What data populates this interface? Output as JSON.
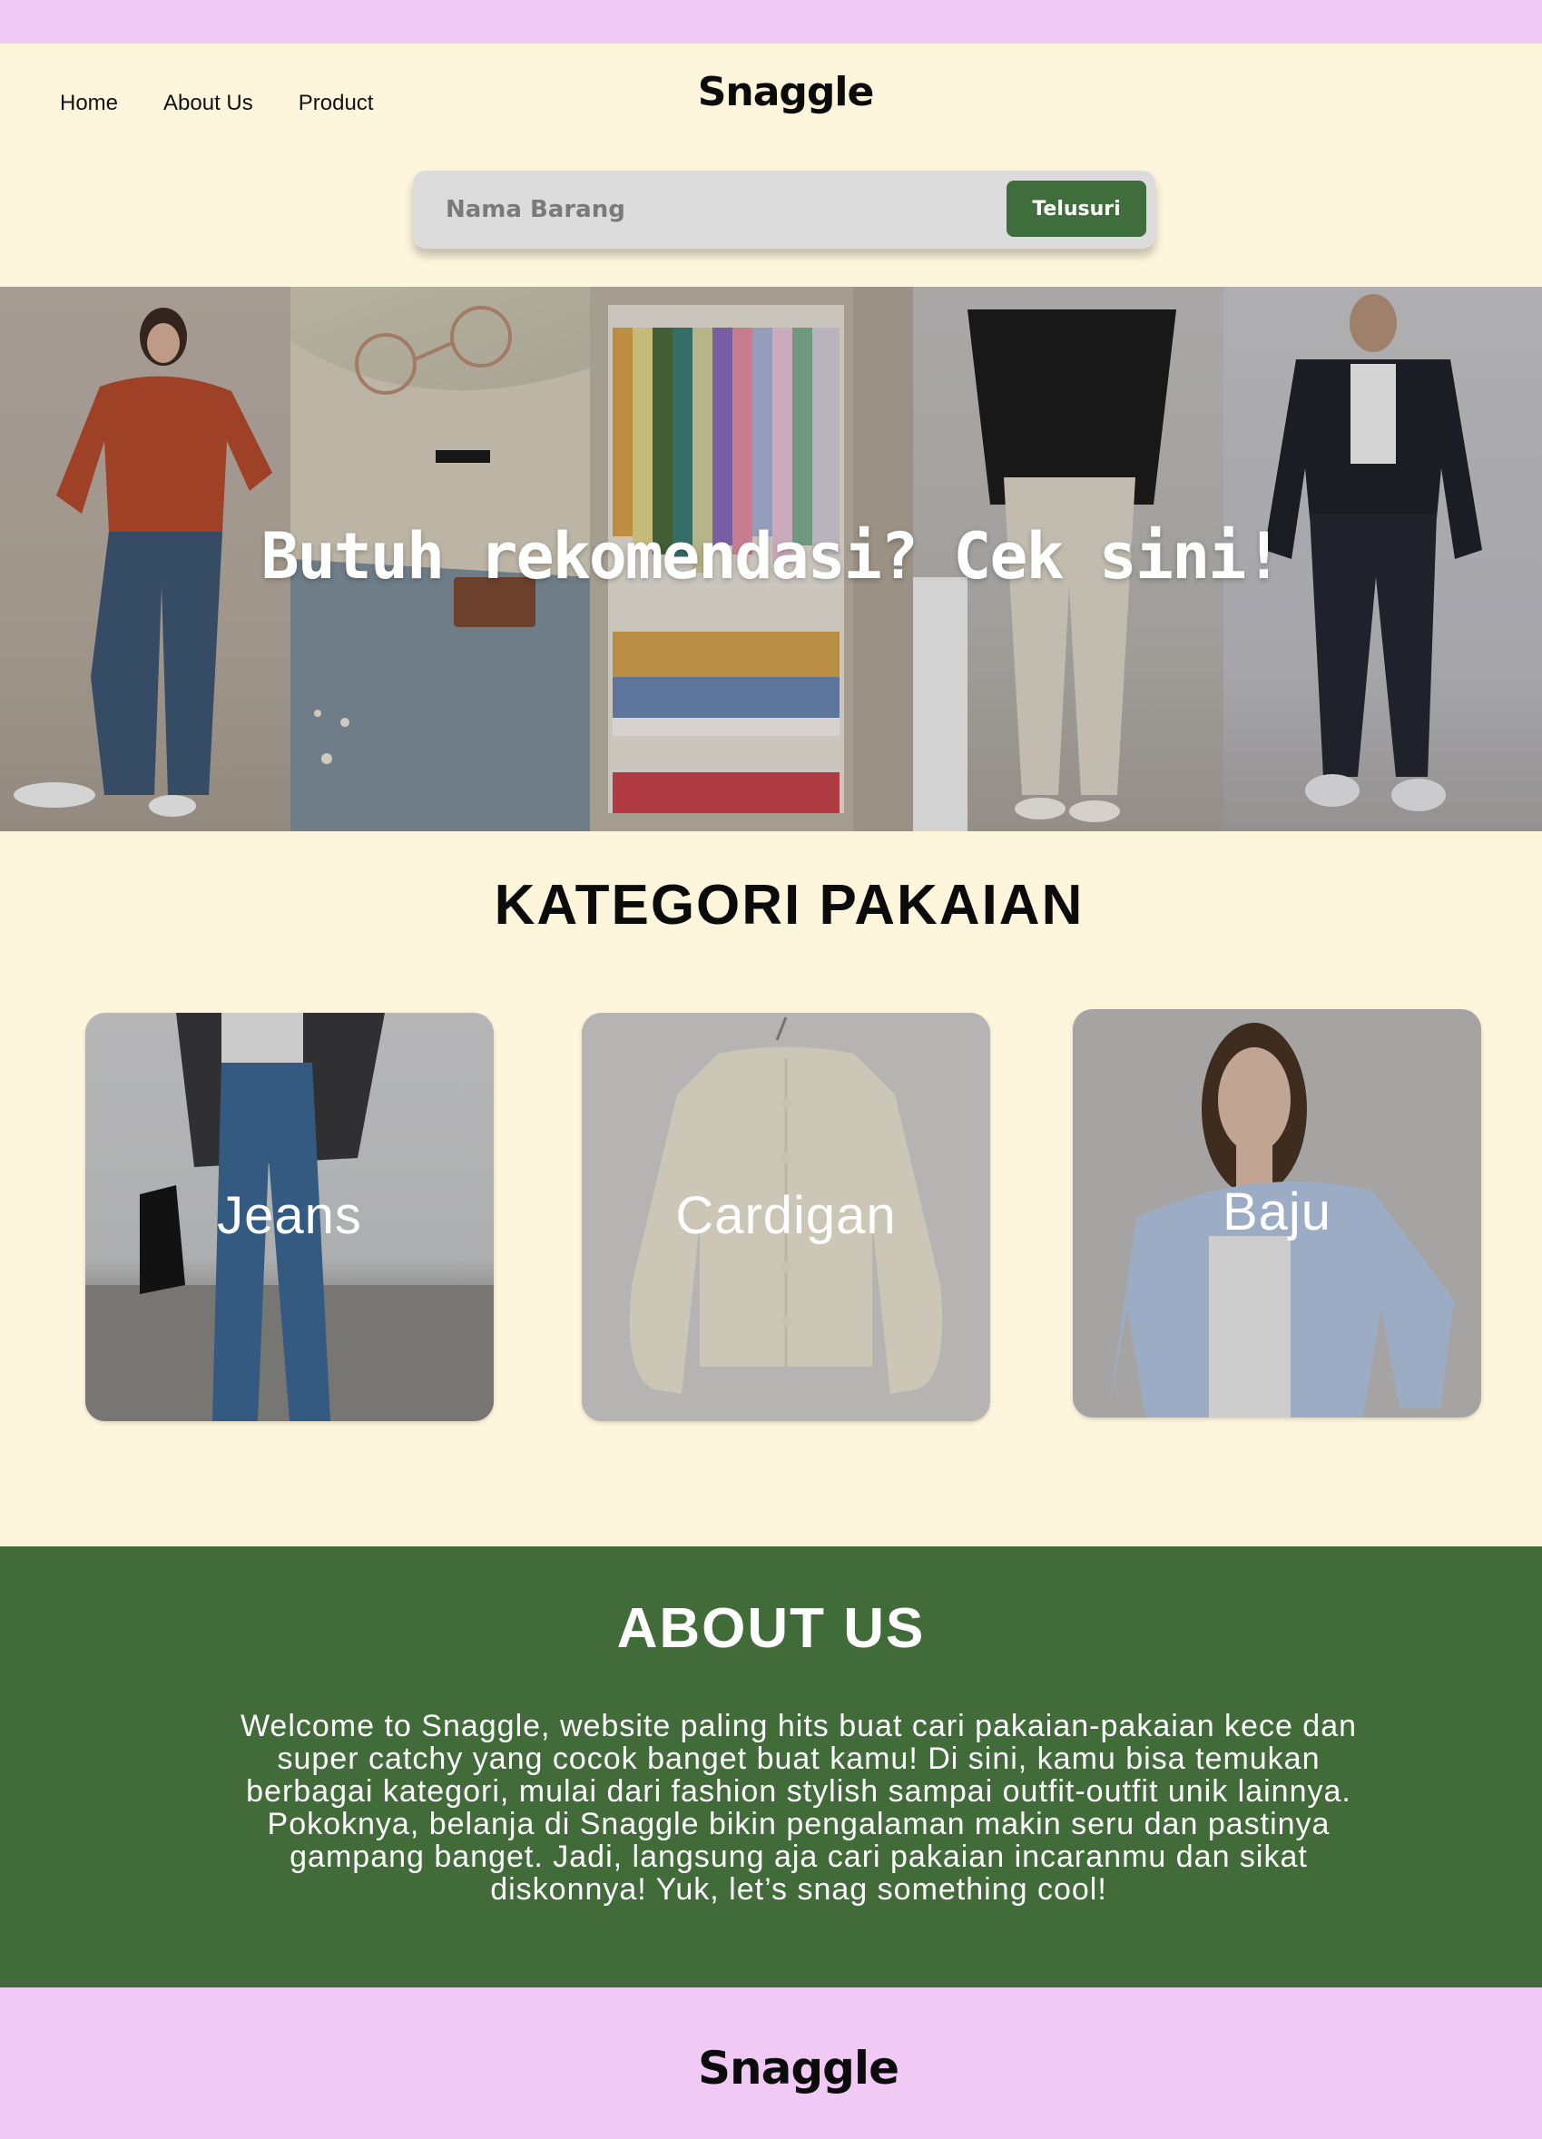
{
  "nav": {
    "items": [
      "Home",
      "About Us",
      "Product"
    ]
  },
  "brand": {
    "name": "Snaggle"
  },
  "search": {
    "placeholder": "Nama Barang",
    "button_label": "Telusuri"
  },
  "hero": {
    "title": "Butuh rekomendasi? Cek sini!"
  },
  "categories": {
    "title": "KATEGORI PAKAIAN",
    "items": [
      "Jeans",
      "Cardigan",
      "Baju"
    ]
  },
  "about": {
    "title": "ABOUT US",
    "text": "Welcome to Snaggle, website paling hits buat cari pakaian-pakaian kece dan super catchy yang cocok banget buat kamu! Di sini, kamu bisa temukan berbagai kategori, mulai dari fashion stylish sampai outfit-outfit unik lainnya. Pokoknya, belanja di Snaggle bikin pengalaman makin seru dan pastinya gampang banget. Jadi, langsung aja cari pakaian incaranmu dan sikat diskonnya! Yuk, let’s snag something cool!"
  },
  "footer": {
    "brand": "Snaggle"
  },
  "colors": {
    "accent_pink": "#f0c9f5",
    "cream": "#fdf5dc",
    "green": "#416c3a",
    "button_green": "#3f6d3b"
  }
}
